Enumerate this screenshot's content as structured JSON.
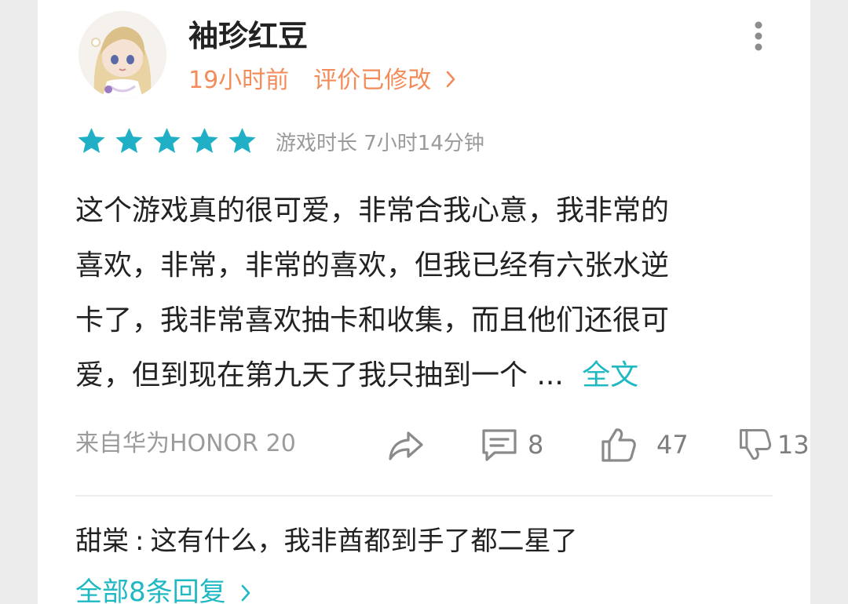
{
  "review": {
    "username": "袖珍红豆",
    "time_ago": "19小时前",
    "edited_label": "评价已修改",
    "rating": 5,
    "rating_max": 5,
    "playtime": "游戏时长 7小时14分钟",
    "content_lines": [
      "这个游戏真的很可爱，非常合我心意，我非常的",
      "喜欢，非常，非常的喜欢，但我已经有六张水逆",
      "卡了，我非常喜欢抽卡和收集，而且他们还很可",
      "爱，但到现在第九天了我只抽到一个"
    ],
    "ellipsis": "...",
    "full_text_label": "全文",
    "device": "来自华为HONOR 20",
    "comment_count": "8",
    "like_count": "47",
    "dislike_count": "13"
  },
  "reply": {
    "author": "甜棠",
    "separator": ":",
    "text": "这有什么，我非酋都到手了都二星了"
  },
  "all_replies_label": "全部8条回复",
  "icons": {
    "more": "more-vertical-icon",
    "star": "star-icon",
    "share": "share-icon",
    "comment": "comment-icon",
    "like": "thumbs-up-icon",
    "dislike": "thumbs-down-icon",
    "chevron": "chevron-right-icon"
  },
  "colors": {
    "accent_teal": "#1fb8c3",
    "meta_orange": "#f28c5a",
    "star_teal": "#1fb0c6",
    "text_primary": "#222222",
    "text_secondary": "#9b9b9b"
  }
}
